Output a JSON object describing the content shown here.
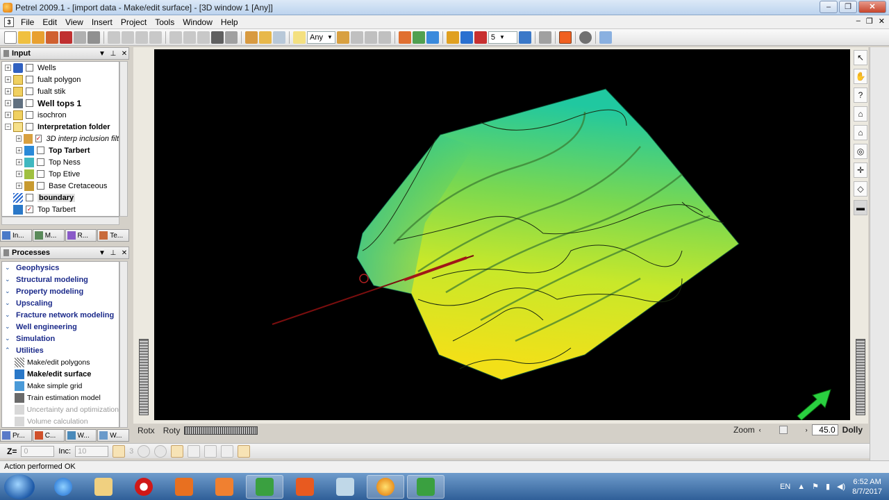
{
  "window": {
    "title": "Petrel 2009.1 - [import data - Make/edit surface] - [3D window 1 [Any]]",
    "controls": {
      "minimize": "–",
      "restore": "❐",
      "close": "✕"
    }
  },
  "menubar": {
    "doc_icon": "3",
    "items": [
      "File",
      "Edit",
      "View",
      "Insert",
      "Project",
      "Tools",
      "Window",
      "Help"
    ],
    "right_controls": [
      "–",
      "❐",
      "✕"
    ]
  },
  "toolbar": {
    "filter_select": "Any",
    "count_select": "5"
  },
  "input_panel": {
    "title": "Input",
    "items": [
      {
        "label": "Wells",
        "checked": false,
        "style": "normal"
      },
      {
        "label": "fualt polygon",
        "checked": false,
        "style": "normal"
      },
      {
        "label": "fualt stik",
        "checked": false,
        "style": "normal"
      },
      {
        "label": "Well tops 1",
        "checked": false,
        "style": "bold-large"
      },
      {
        "label": "isochron",
        "checked": false,
        "style": "normal"
      },
      {
        "label": "Interpretation folder",
        "checked": false,
        "style": "bold"
      },
      {
        "label": "3D interp inclusion filt",
        "checked": true,
        "style": "italic"
      },
      {
        "label": "Top Tarbert",
        "checked": false,
        "style": "bold"
      },
      {
        "label": "Top Ness",
        "checked": false,
        "style": "normal"
      },
      {
        "label": "Top Etive",
        "checked": false,
        "style": "normal"
      },
      {
        "label": "Base Cretaceous",
        "checked": false,
        "style": "normal"
      },
      {
        "label": "boundary",
        "checked": false,
        "style": "bold-selected"
      },
      {
        "label": "Top Tarbert",
        "checked": true,
        "style": "normal"
      }
    ],
    "tabs": [
      "In...",
      "M...",
      "R...",
      "Te..."
    ]
  },
  "processes_panel": {
    "title": "Processes",
    "groups": [
      "Geophysics",
      "Structural modeling",
      "Property modeling",
      "Upscaling",
      "Fracture network modeling",
      "Well engineering",
      "Simulation",
      "Utilities"
    ],
    "utilities": [
      {
        "label": "Make/edit polygons",
        "style": "normal"
      },
      {
        "label": "Make/edit surface",
        "style": "bold"
      },
      {
        "label": "Make simple grid",
        "style": "normal"
      },
      {
        "label": "Train estimation model",
        "style": "normal"
      },
      {
        "label": "Uncertainty and optimization",
        "style": "disabled"
      },
      {
        "label": "Volume calculation",
        "style": "disabled"
      }
    ],
    "tabs": [
      "Pr...",
      "C...",
      "W...",
      "W..."
    ]
  },
  "viewport": {
    "right_tools": [
      "↖",
      "✋",
      "?",
      "⌂",
      "⌂",
      "◎",
      "✛",
      "◇",
      "▬"
    ]
  },
  "navigation": {
    "rotx_label": "Rotx",
    "roty_label": "Roty",
    "zoom_label": "Zoom",
    "zoom_value": "45.0",
    "dolly_label": "Dolly"
  },
  "bottom_toolbar": {
    "z_label": "Z=",
    "z_value": "0",
    "inc_label": "Inc:",
    "inc_value": "10",
    "count_value": "3"
  },
  "status": {
    "message": "Action performed OK"
  },
  "taskbar": {
    "language": "EN",
    "time": "6:52 AM",
    "date": "8/7/2017"
  },
  "colors": {
    "surface_high": "#18c8a0",
    "surface_mid": "#a8e830",
    "surface_low": "#f0e020",
    "viewport_bg": "#000000",
    "well_line": "#8a1010"
  }
}
